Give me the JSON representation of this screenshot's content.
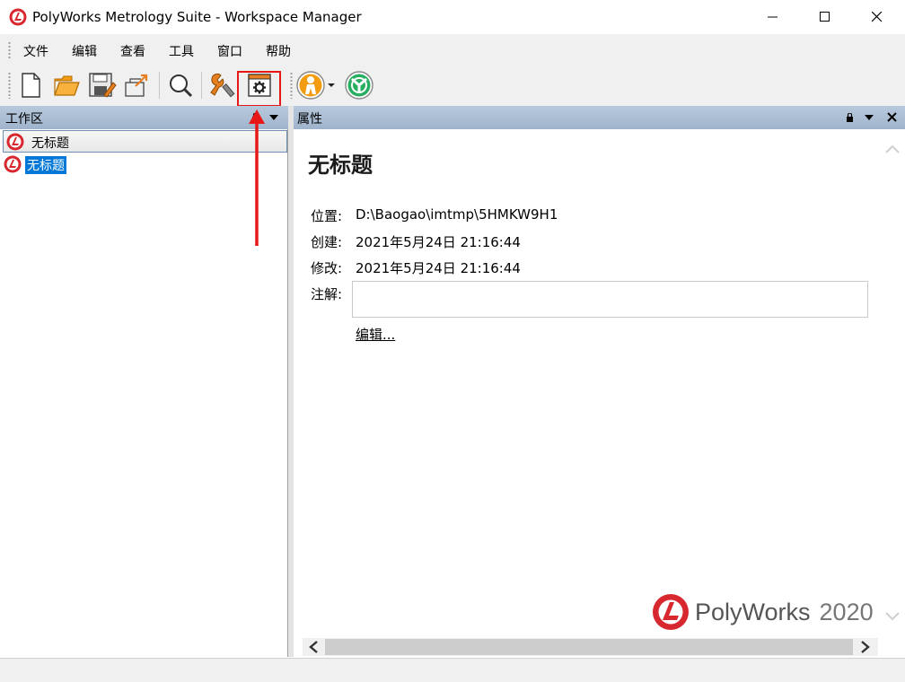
{
  "window": {
    "title": "PolyWorks Metrology Suite - Workspace Manager"
  },
  "menu": {
    "items": [
      {
        "label": "文件"
      },
      {
        "label": "编辑"
      },
      {
        "label": "查看"
      },
      {
        "label": "工具"
      },
      {
        "label": "窗口"
      },
      {
        "label": "帮助"
      }
    ]
  },
  "toolbar": {
    "buttons": [
      {
        "icon": "new-document-icon"
      },
      {
        "icon": "open-folder-icon"
      },
      {
        "icon": "save-icon"
      },
      {
        "icon": "export-icon"
      },
      {
        "icon": "magnifier-icon"
      },
      {
        "icon": "wrench-tools-icon"
      },
      {
        "icon": "settings-window-icon"
      },
      {
        "icon": "user-avatar-icon"
      },
      {
        "icon": "module-launcher-icon"
      }
    ],
    "highlight_color": "#e81818"
  },
  "workspace_panel": {
    "title": "工作区",
    "items": [
      {
        "label": "无标题"
      },
      {
        "label": "无标题"
      }
    ]
  },
  "properties_panel": {
    "title": "属性",
    "heading": "无标题",
    "fields": {
      "location_label": "位置:",
      "location_value": "D:\\Baogao\\imtmp\\5HMKW9H1",
      "created_label": "创建:",
      "created_value": "2021年5月24日 21:16:44",
      "modified_label": "修改:",
      "modified_value": "2021年5月24日 21:16:44",
      "notes_label": "注解:",
      "notes_value": ""
    },
    "edit_link": "编辑..."
  },
  "branding": {
    "name": "PolyWorks",
    "year": "2020",
    "brand_color": "#d7282f"
  },
  "colors": {
    "panel_header": "#a9bdd3",
    "selection": "#0078d7"
  }
}
